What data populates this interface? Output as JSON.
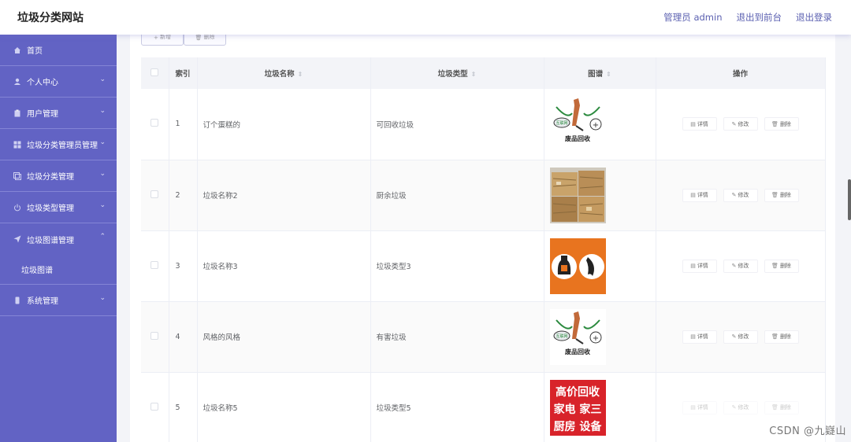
{
  "header": {
    "title": "垃圾分类网站",
    "links": [
      "管理员 admin",
      "退出到前台",
      "退出登录"
    ]
  },
  "sidebar": {
    "items": [
      {
        "label": "首页",
        "icon": "home-icon",
        "has_arrow": false
      },
      {
        "label": "个人中心",
        "icon": "user-icon",
        "has_arrow": true
      },
      {
        "label": "用户管理",
        "icon": "clipboard-icon",
        "has_arrow": true
      },
      {
        "label": "垃圾分类管理员管理",
        "icon": "grid-icon",
        "has_arrow": true
      },
      {
        "label": "垃圾分类管理",
        "icon": "copy-icon",
        "has_arrow": true
      },
      {
        "label": "垃圾类型管理",
        "icon": "power-icon",
        "has_arrow": true
      },
      {
        "label": "垃圾图谱管理",
        "icon": "send-icon",
        "has_arrow": true,
        "expanded": true
      },
      {
        "label": "系统管理",
        "icon": "phone-icon",
        "has_arrow": true
      }
    ],
    "submenu": "垃圾图谱"
  },
  "toolbar": {
    "add_label": "新增",
    "delete_label": "删除"
  },
  "table": {
    "columns": [
      "索引",
      "垃圾名称",
      "垃圾类型",
      "图谱",
      "操作"
    ],
    "rows": [
      {
        "index": "1",
        "name": "订个蛋糕的",
        "type": "可回收垃圾",
        "image": "recycle-logo"
      },
      {
        "index": "2",
        "name": "垃圾名称2",
        "type": "厨余垃圾",
        "image": "cardboard-bales"
      },
      {
        "index": "3",
        "name": "垃圾名称3",
        "type": "垃圾类型3",
        "image": "orange-bottles"
      },
      {
        "index": "4",
        "name": "风格的风格",
        "type": "有害垃圾",
        "image": "recycle-logo"
      },
      {
        "index": "5",
        "name": "垃圾名称5",
        "type": "垃圾类型5",
        "image": "red-sign"
      }
    ],
    "ops": {
      "detail": "详情",
      "edit": "修改",
      "delete": "删除"
    },
    "recycle_logo_text": "废品回收",
    "recycle_logo_badge": "互联网",
    "red_sign_text": "高价回收 家电 家三 厨房 设备"
  },
  "watermark": "CSDN @九嶷山",
  "colors": {
    "sidebar_bg": "#6263c4",
    "header_link": "#5a5fb0",
    "table_header_bg": "#f3f4f8"
  }
}
